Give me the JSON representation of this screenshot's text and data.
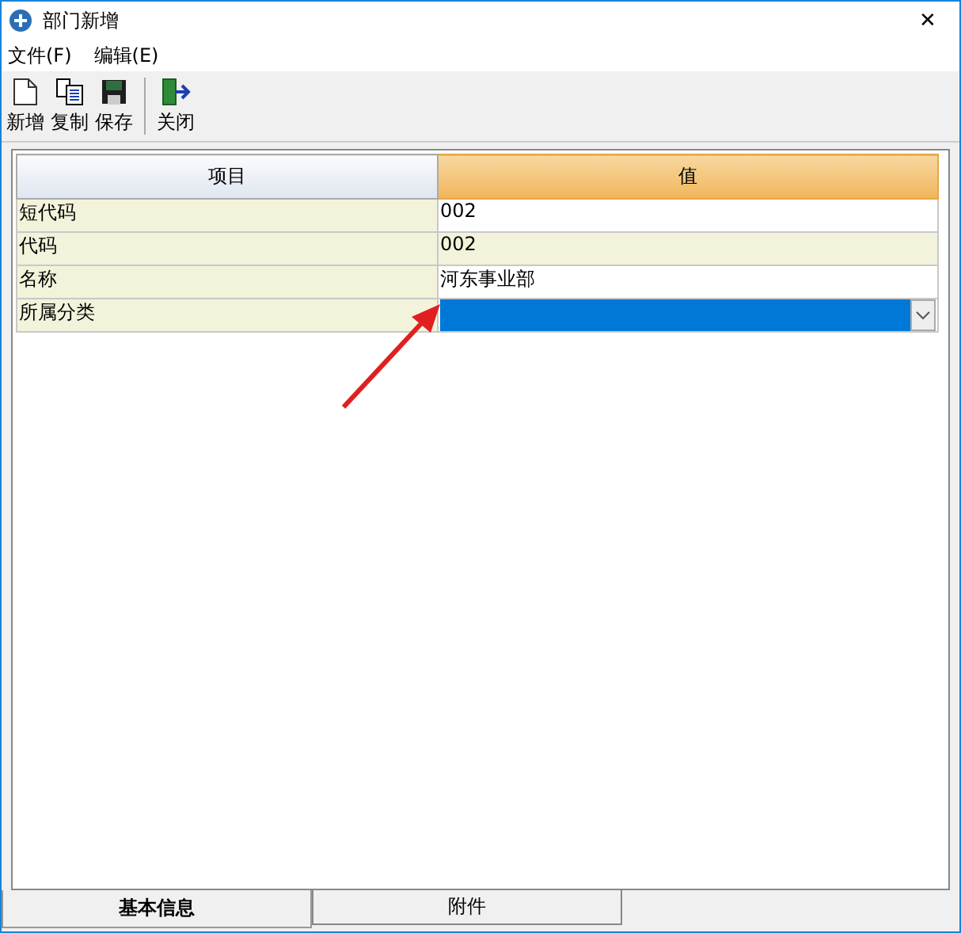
{
  "window": {
    "title": "部门新增",
    "close": "✕"
  },
  "menu": [
    {
      "label": "文件(F)"
    },
    {
      "label": "编辑(E)"
    }
  ],
  "toolbar": [
    {
      "label": "新增",
      "kind": "new"
    },
    {
      "label": "复制",
      "kind": "copy"
    },
    {
      "label": "保存",
      "kind": "save"
    },
    {
      "label": "关闭",
      "kind": "exit"
    }
  ],
  "grid": {
    "columns": [
      {
        "label": "项目",
        "selected": false
      },
      {
        "label": "值",
        "selected": true
      }
    ],
    "rows": [
      {
        "name": "短代码",
        "value": "002",
        "kind": "text",
        "readonly": false,
        "focused": false
      },
      {
        "name": "代码",
        "value": "002",
        "kind": "text",
        "readonly": true,
        "focused": false
      },
      {
        "name": "名称",
        "value": "河东事业部",
        "kind": "text",
        "readonly": false,
        "focused": false
      },
      {
        "name": "所属分类",
        "kind": "dropdown",
        "readonly": false,
        "focused": true
      }
    ]
  },
  "tabs": [
    {
      "label": "基本信息",
      "selected": true
    },
    {
      "label": "附件",
      "selected": false
    }
  ]
}
